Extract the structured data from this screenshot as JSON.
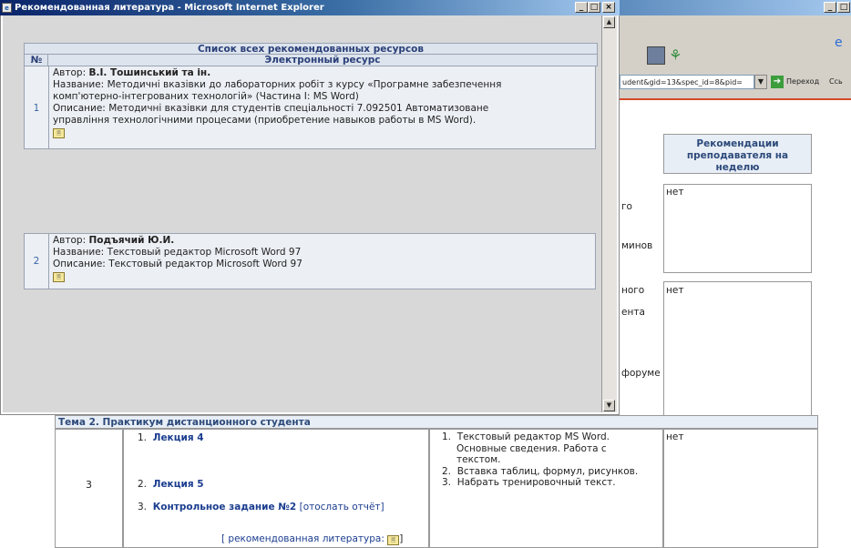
{
  "background": {
    "window_title_right_buttons": [
      "_",
      "□"
    ],
    "address_url": "udent&gid=13&spec_id=8&pid=",
    "go_label": "Переход",
    "links_label": "Ссь",
    "column_header": "Рекомендации преподавателя на неделю",
    "fragments": [
      "го",
      "минов",
      "ного",
      "ента",
      "форуме"
    ],
    "no_values": [
      "нет",
      "нет"
    ]
  },
  "popup": {
    "title": "Рекомендованная литература - Microsoft Internet Explorer",
    "title_buttons": [
      "_",
      "□",
      "×"
    ],
    "table_title": "Список всех рекомендованных ресурсов",
    "col_num": "№",
    "col_resource": "Электронный ресурс",
    "rows": [
      {
        "num": "1",
        "author_label": "Автор:",
        "author": "В.І. Тошинський та ін.",
        "name_label": "Название:",
        "name_line1": "Методичні вказівки до лабораторних робіт з курсу «Програмне забезпечення",
        "name_line2": "комп'ютерно-інтегрованих технологій» (Частина І: MS Word)",
        "desc_label": "Описание:",
        "desc_line1": "Методичні вказівки для студентів спеціальності 7.092501 Автоматизоване",
        "desc_line2": "управління технологічними процесами (приобретение навыков работы в MS Word)."
      },
      {
        "num": "2",
        "author_label": "Автор:",
        "author": "Подъячий Ю.И.",
        "name_label": "Название:",
        "name_line1": "Текстовый редактор Microsoft Word 97",
        "desc_label": "Описание:",
        "desc_line1": "Текстовый редактор Microsoft Word 97"
      }
    ]
  },
  "lower": {
    "theme": "Тема 2. Практикум дистанционного студента",
    "week_num": "3",
    "lectures": [
      {
        "n": "1.",
        "label": "Лекция 4"
      },
      {
        "n": "2.",
        "label": "Лекция 5"
      },
      {
        "n": "3.",
        "label": "Контрольное задание №2",
        "link": "[отослать отчёт]"
      }
    ],
    "lit_link": "[ рекомендованная литература:",
    "lit_close": "]",
    "topics": [
      {
        "n": "1.",
        "lines": [
          "Текстовый редактор MS Word.",
          "Основные сведения. Работа с",
          "текстом."
        ]
      },
      {
        "n": "2.",
        "lines": [
          "Вставка таблиц, формул, рисунков."
        ]
      },
      {
        "n": "3.",
        "lines": [
          "Набрать тренировочный текст."
        ]
      }
    ],
    "rec": "нет"
  }
}
